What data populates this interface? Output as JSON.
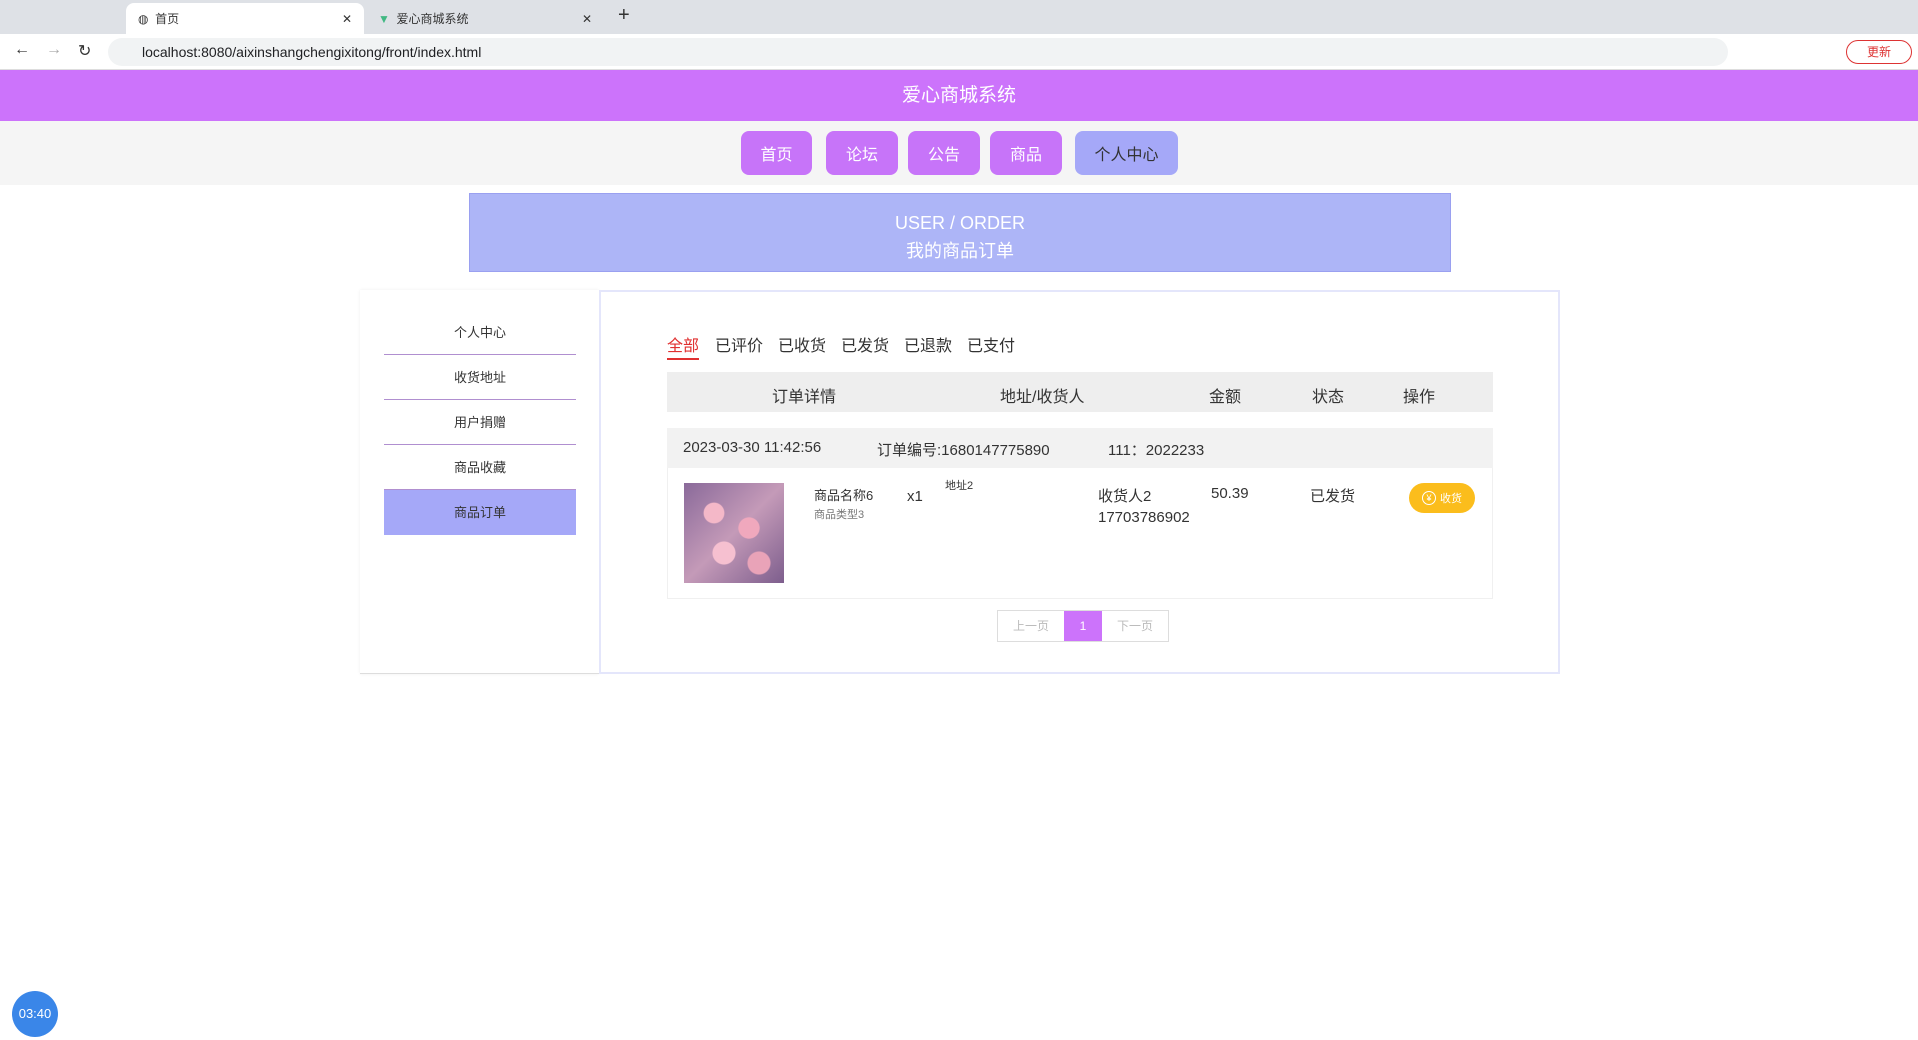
{
  "browser": {
    "tabs": [
      {
        "title": "首页"
      },
      {
        "title": "爱心商城系统"
      }
    ],
    "url": "localhost:8080/aixinshangchengixitong/front/index.html",
    "update_label": "更新"
  },
  "header": {
    "title": "爱心商城系统"
  },
  "nav": [
    "首页",
    "论坛",
    "公告",
    "商品",
    "个人中心"
  ],
  "banner": {
    "en": "USER / ORDER",
    "cn": "我的商品订单"
  },
  "sidebar": [
    "个人中心",
    "收货地址",
    "用户捐赠",
    "商品收藏",
    "商品订单"
  ],
  "order_tabs": [
    "全部",
    "已评价",
    "已收货",
    "已发货",
    "已退款",
    "已支付"
  ],
  "table_headers": [
    "订单详情",
    "地址/收货人",
    "金额",
    "状态",
    "操作"
  ],
  "order": {
    "time": "2023-03-30 11:42:56",
    "number": "订单编号:1680147775890",
    "user": "111：2022233",
    "product_name": "商品名称6",
    "product_type": "商品类型3",
    "qty": "x1",
    "address": "地址2",
    "receiver": "收货人2",
    "phone": "17703786902",
    "amount": "50.39",
    "status": "已发货",
    "action": "收货"
  },
  "pagination": {
    "prev": "上一页",
    "current": "1",
    "next": "下一页"
  },
  "clock": "03:40"
}
